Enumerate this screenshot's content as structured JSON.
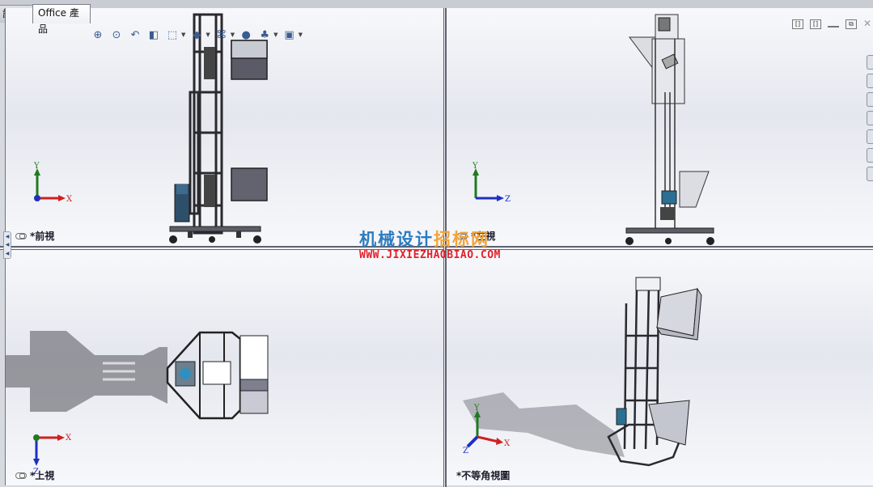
{
  "tabs": [
    {
      "label": "評估",
      "active": false
    },
    {
      "label": "Office 產品",
      "active": true
    }
  ],
  "heads_up_toolbar": [
    {
      "icon": "zoom-to-fit-icon",
      "glyph": "⊕",
      "dropdown": false
    },
    {
      "icon": "zoom-to-area-icon",
      "glyph": "⊙",
      "dropdown": false
    },
    {
      "icon": "previous-view-icon",
      "glyph": "↶",
      "dropdown": false
    },
    {
      "icon": "section-view-icon",
      "glyph": "◧",
      "dropdown": false
    },
    {
      "icon": "view-orientation-icon",
      "glyph": "⬚",
      "dropdown": true
    },
    {
      "icon": "display-style-icon",
      "glyph": "◆",
      "dropdown": true
    },
    {
      "icon": "hide-show-items-icon",
      "glyph": "⌘",
      "dropdown": true
    },
    {
      "icon": "edit-appearance-icon",
      "glyph": "●",
      "dropdown": false
    },
    {
      "icon": "apply-scene-icon",
      "glyph": "♣",
      "dropdown": true
    },
    {
      "icon": "view-settings-icon",
      "glyph": "▣",
      "dropdown": true
    }
  ],
  "window_controls": {
    "tile_left": "[]",
    "tile_right": "[]",
    "minimize": "",
    "restore": "⧉",
    "close": "✕"
  },
  "viewports": {
    "front": {
      "label": "*前視",
      "axes": [
        "Y",
        "X"
      ]
    },
    "right": {
      "label": "*左視",
      "axes": [
        "Y",
        "Z"
      ]
    },
    "top": {
      "label": "*上視",
      "axes": [
        "X",
        "Z"
      ]
    },
    "iso": {
      "label": "*不等角視圖",
      "axes": [
        "Y",
        "X",
        "Z"
      ]
    }
  },
  "watermark": {
    "title_part1": "机械设计",
    "title_part2": "招标网",
    "url": "WWW.JIXIEZHAOBIAO.COM"
  },
  "colors": {
    "axis_x": "#d02020",
    "axis_y": "#1f7a1f",
    "axis_z": "#1f2fbf",
    "watermark_blue": "#2b7bbf",
    "watermark_orange": "#f2a43a",
    "watermark_red": "#e3202a"
  }
}
